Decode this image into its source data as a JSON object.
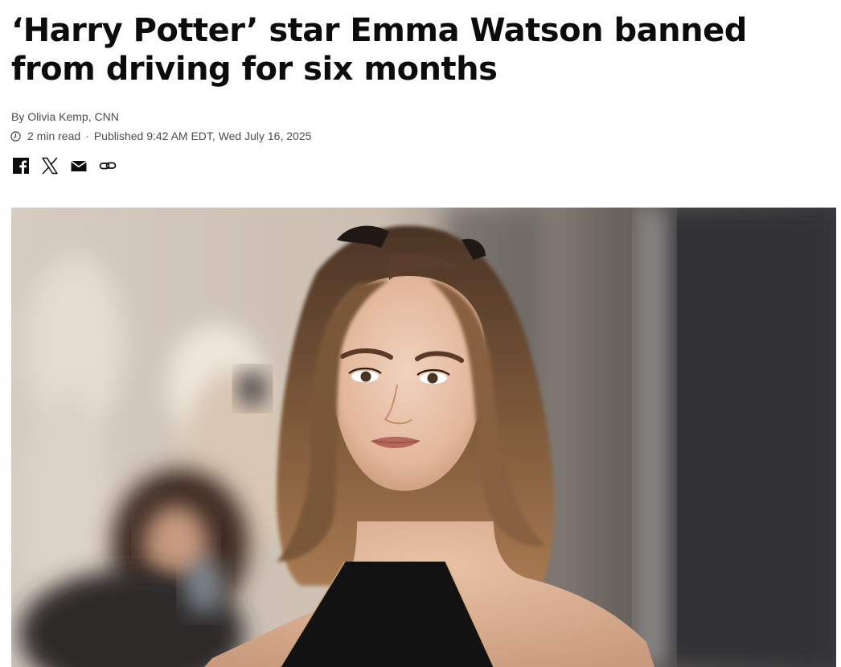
{
  "article": {
    "headline": "‘Harry Potter’ star Emma Watson banned from driving for six months",
    "byline_prefix": "By ",
    "author": "Olivia Kemp",
    "byline_separator": ", ",
    "outlet": "CNN",
    "read_time": "2 min read",
    "meta_separator": "·",
    "published": "Published 9:42 AM EDT, Wed July 16, 2025"
  },
  "share": {
    "icons": [
      "facebook-icon",
      "x-icon",
      "email-icon",
      "link-icon"
    ]
  },
  "image": {
    "subject": "portrait-photo"
  },
  "colors": {
    "text": "#0c0c0c",
    "meta_text": "#4d4d4d",
    "background": "#ffffff"
  }
}
